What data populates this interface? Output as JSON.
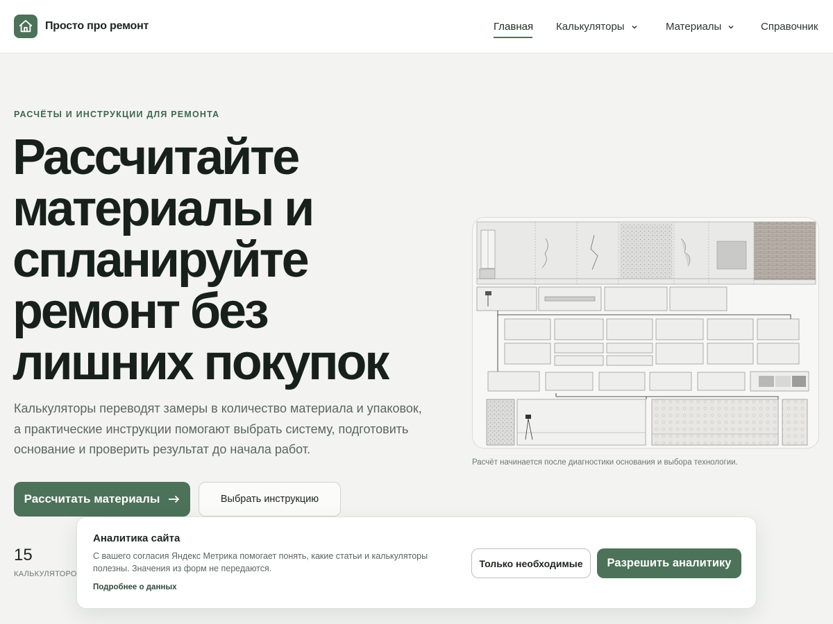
{
  "brand": {
    "name": "Просто про ремонт",
    "logo_icon": "house-icon",
    "accent": "#4c7259"
  },
  "nav": {
    "items": [
      {
        "label": "Главная",
        "active": true
      },
      {
        "label": "Калькуляторы",
        "has_dropdown": true
      },
      {
        "label": "Материалы",
        "has_dropdown": true
      },
      {
        "label": "Справочник"
      }
    ]
  },
  "hero": {
    "eyebrow": "РАСЧЁТЫ И ИНСТРУКЦИИ ДЛЯ РЕМОНТА",
    "headline_lines": [
      "Рассчитайте",
      "материалы и",
      "спланируйте",
      "ремонт без",
      "лишних покупок"
    ],
    "lead": "Калькуляторы переводят замеры в количество материала и упаковок, а практические инструкции помогают выбрать систему, подготовить основание и проверить результат до начала работ.",
    "primary_button": "Рассчитать материалы",
    "primary_icon": "arrow-right-icon",
    "secondary_button": "Выбрать инструкцию",
    "stat_value": "15",
    "stat_label": "КАЛЬКУЛЯТОРОВ"
  },
  "figure": {
    "caption": "Расчёт начинается после диагностики основания и выбора технологии."
  },
  "consent": {
    "title": "Аналитика сайта",
    "text": "С вашего согласия Яндекс Метрика помогает понять, какие статьи и калькуляторы полезны. Значения из форм не передаются.",
    "link": "Подробнее о данных",
    "necessary_button": "Только необходимые",
    "allow_button": "Разрешить аналитику"
  }
}
